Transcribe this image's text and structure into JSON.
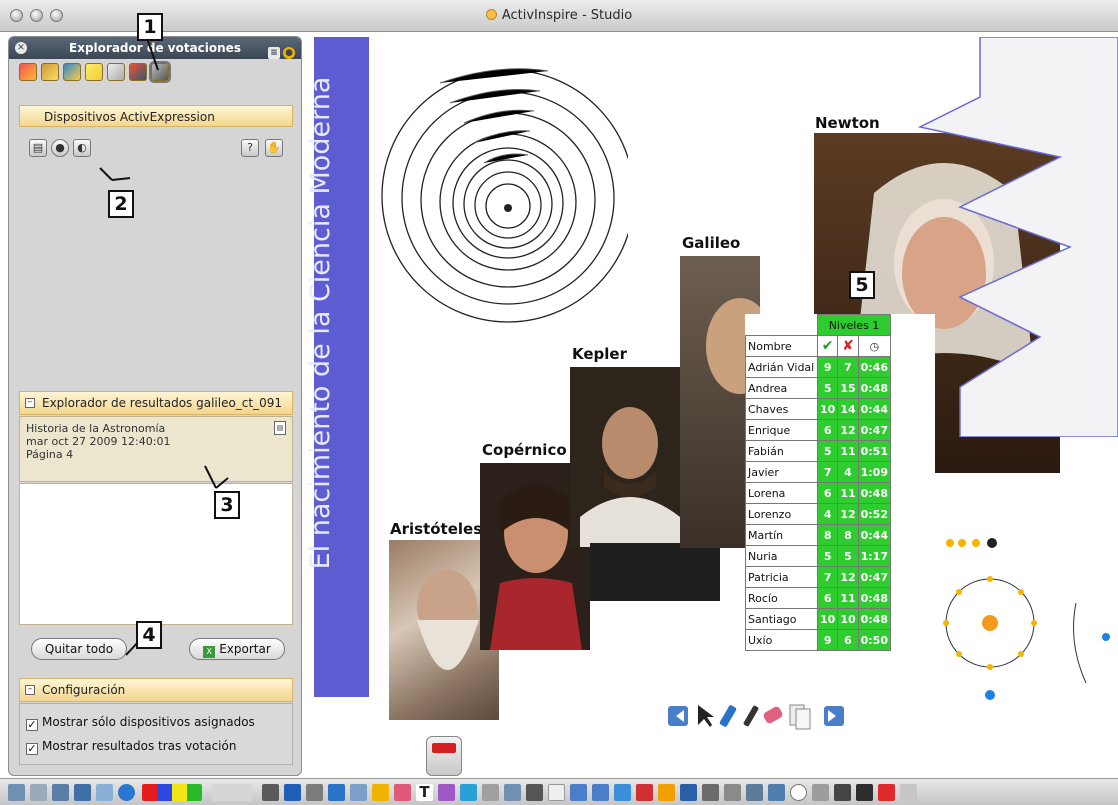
{
  "window": {
    "title": "ActivInspire - Studio"
  },
  "panel": {
    "title": "Explorador de votaciones",
    "devices_section_label": "Dispositivos ActivExpression",
    "results_section_label": "Explorador de resultados galileo_ct_091",
    "results_info": {
      "line1": "Historia de la Astronomía",
      "line2": "mar oct 27 2009 12:40:01",
      "line3": "Página  4"
    },
    "quitar_label": "Quitar todo",
    "exportar_label": "Exportar",
    "config_label": "Configuración",
    "option1_label": "Mostrar sólo dispositivos asignados",
    "option2_label": "Mostrar resultados tras votación"
  },
  "callouts": {
    "c1": "1",
    "c2": "2",
    "c3": "3",
    "c4": "4",
    "c5": "5"
  },
  "flipchart": {
    "vertical_title": "El nacimiento de la Ciencia Moderna",
    "portraits": {
      "aristoteles": "Aristóteles",
      "copernico": "Copérnico",
      "kepler": "Kepler",
      "galileo": "Galileo",
      "newton": "Newton"
    },
    "results_table": {
      "title": "Niveles 1",
      "name_header": "Nombre",
      "rows": [
        {
          "name": "Adrián Vidal",
          "ok": "9",
          "ko": "7",
          "time": "0:46"
        },
        {
          "name": "Andrea",
          "ok": "5",
          "ko": "15",
          "time": "0:48"
        },
        {
          "name": "Chaves",
          "ok": "10",
          "ko": "14",
          "time": "0:44"
        },
        {
          "name": "Enrique",
          "ok": "6",
          "ko": "12",
          "time": "0:47"
        },
        {
          "name": "Fabián",
          "ok": "5",
          "ko": "11",
          "time": "0:51"
        },
        {
          "name": "Javier",
          "ok": "7",
          "ko": "4",
          "time": "1:09"
        },
        {
          "name": "Lorena",
          "ok": "6",
          "ko": "11",
          "time": "0:48"
        },
        {
          "name": "Lorenzo",
          "ok": "4",
          "ko": "12",
          "time": "0:52"
        },
        {
          "name": "Martín",
          "ok": "8",
          "ko": "8",
          "time": "0:44"
        },
        {
          "name": "Nuria",
          "ok": "5",
          "ko": "5",
          "time": "1:17"
        },
        {
          "name": "Patricia",
          "ok": "7",
          "ko": "12",
          "time": "0:47"
        },
        {
          "name": "Rocío",
          "ok": "6",
          "ko": "11",
          "time": "0:48"
        },
        {
          "name": "Santiago",
          "ok": "10",
          "ko": "10",
          "time": "0:48"
        },
        {
          "name": "Uxío",
          "ok": "9",
          "ko": "6",
          "time": "0:50"
        }
      ]
    }
  },
  "colors": {
    "accent_bar": "#5d5cd1",
    "table_green": "#2ecc2e",
    "section_gold": "#f3d68e"
  }
}
